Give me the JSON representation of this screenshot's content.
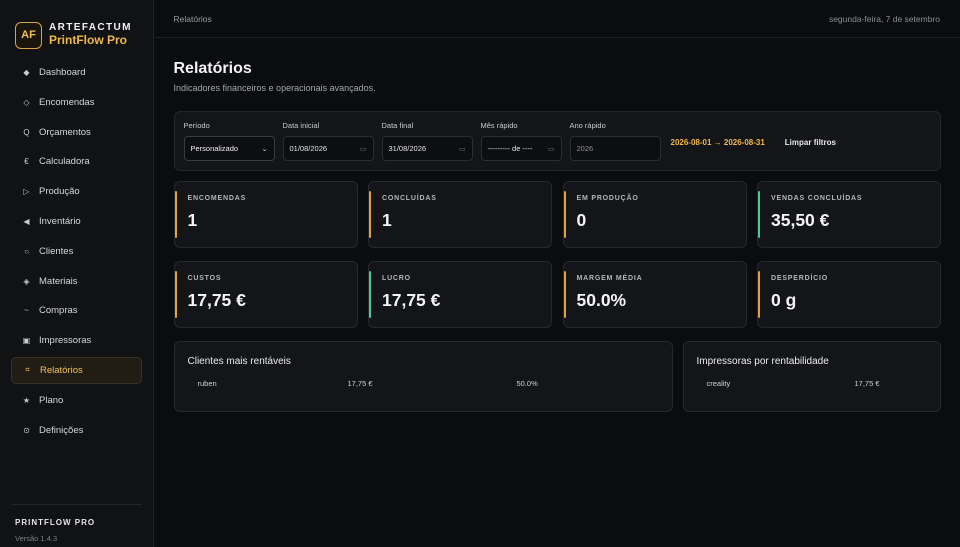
{
  "brand": {
    "logo": "AF",
    "top": "ARTEFACTUM",
    "name": "PrintFlow Pro"
  },
  "nav": [
    {
      "label": "Dashboard",
      "icon": "◆",
      "icon_name": "diamond-icon",
      "active": false
    },
    {
      "label": "Encomendas",
      "icon": "◇",
      "icon_name": "diamond-outline-icon",
      "active": false
    },
    {
      "label": "Orçamentos",
      "icon": "Q",
      "icon_name": "quote-icon",
      "active": false
    },
    {
      "label": "Calculadora",
      "icon": "€",
      "icon_name": "euro-icon",
      "active": false
    },
    {
      "label": "Produção",
      "icon": "▷",
      "icon_name": "play-icon",
      "active": false
    },
    {
      "label": "Inventário",
      "icon": "◀",
      "icon_name": "triangle-left-icon",
      "active": false
    },
    {
      "label": "Clientes",
      "icon": "○",
      "icon_name": "circle-icon",
      "active": false
    },
    {
      "label": "Materiais",
      "icon": "◈",
      "icon_name": "diamond-dot-icon",
      "active": false
    },
    {
      "label": "Compras",
      "icon": "~",
      "icon_name": "tilde-icon",
      "active": false
    },
    {
      "label": "Impressoras",
      "icon": "▣",
      "icon_name": "printer-icon",
      "active": false
    },
    {
      "label": "Relatórios",
      "icon": "⌗",
      "icon_name": "hash-icon",
      "active": true
    },
    {
      "label": "Plano",
      "icon": "★",
      "icon_name": "star-icon",
      "active": false
    },
    {
      "label": "Definições",
      "icon": "⊙",
      "icon_name": "settings-icon",
      "active": false
    }
  ],
  "footer": {
    "title": "PRINTFLOW PRO",
    "version": "Versão 1.4.3"
  },
  "topbar": {
    "breadcrumb": "Relatórios",
    "date": "segunda-feira, 7 de setembro"
  },
  "page": {
    "title": "Relatórios",
    "subtitle": "Indicadores financeiros e operacionais avançados."
  },
  "filters": {
    "period": {
      "label": "Período",
      "value": "Personalizado"
    },
    "start": {
      "label": "Data inicial",
      "value": "01/08/2026"
    },
    "end": {
      "label": "Data final",
      "value": "31/08/2026"
    },
    "month": {
      "label": "Mês rápido",
      "value": "--------- de ----"
    },
    "year": {
      "label": "Ano rápido",
      "value": "2026"
    },
    "range": "2026-08-01 → 2026-08-31",
    "clear": "Limpar filtros"
  },
  "stats": [
    {
      "label": "ENCOMENDAS",
      "value": "1",
      "color": "#e0a13c"
    },
    {
      "label": "CONCLUÍDAS",
      "value": "1",
      "color": "#e0a13c"
    },
    {
      "label": "EM PRODUÇÃO",
      "value": "0",
      "color": "#e0a13c"
    },
    {
      "label": "VENDAS CONCLUÍDAS",
      "value": "35,50 €",
      "color": "#4fc891"
    },
    {
      "label": "CUSTOS",
      "value": "17,75 €",
      "color": "#e0a13c"
    },
    {
      "label": "LUCRO",
      "value": "17,75 €",
      "color": "#4fc891"
    },
    {
      "label": "MARGEM MÉDIA",
      "value": "50.0%",
      "color": "#e0a13c"
    },
    {
      "label": "DESPERDÍCIO",
      "value": "0 g",
      "color": "#e0a13c"
    }
  ],
  "clients_panel": {
    "title": "Clientes mais rentáveis",
    "rows": [
      {
        "name": "ruben",
        "profit": "17,75 €",
        "margin": "50.0%"
      }
    ]
  },
  "printers_panel": {
    "title": "Impressoras por rentabilidade",
    "rows": [
      {
        "name": "creality",
        "profit": "17,75 €"
      }
    ]
  }
}
